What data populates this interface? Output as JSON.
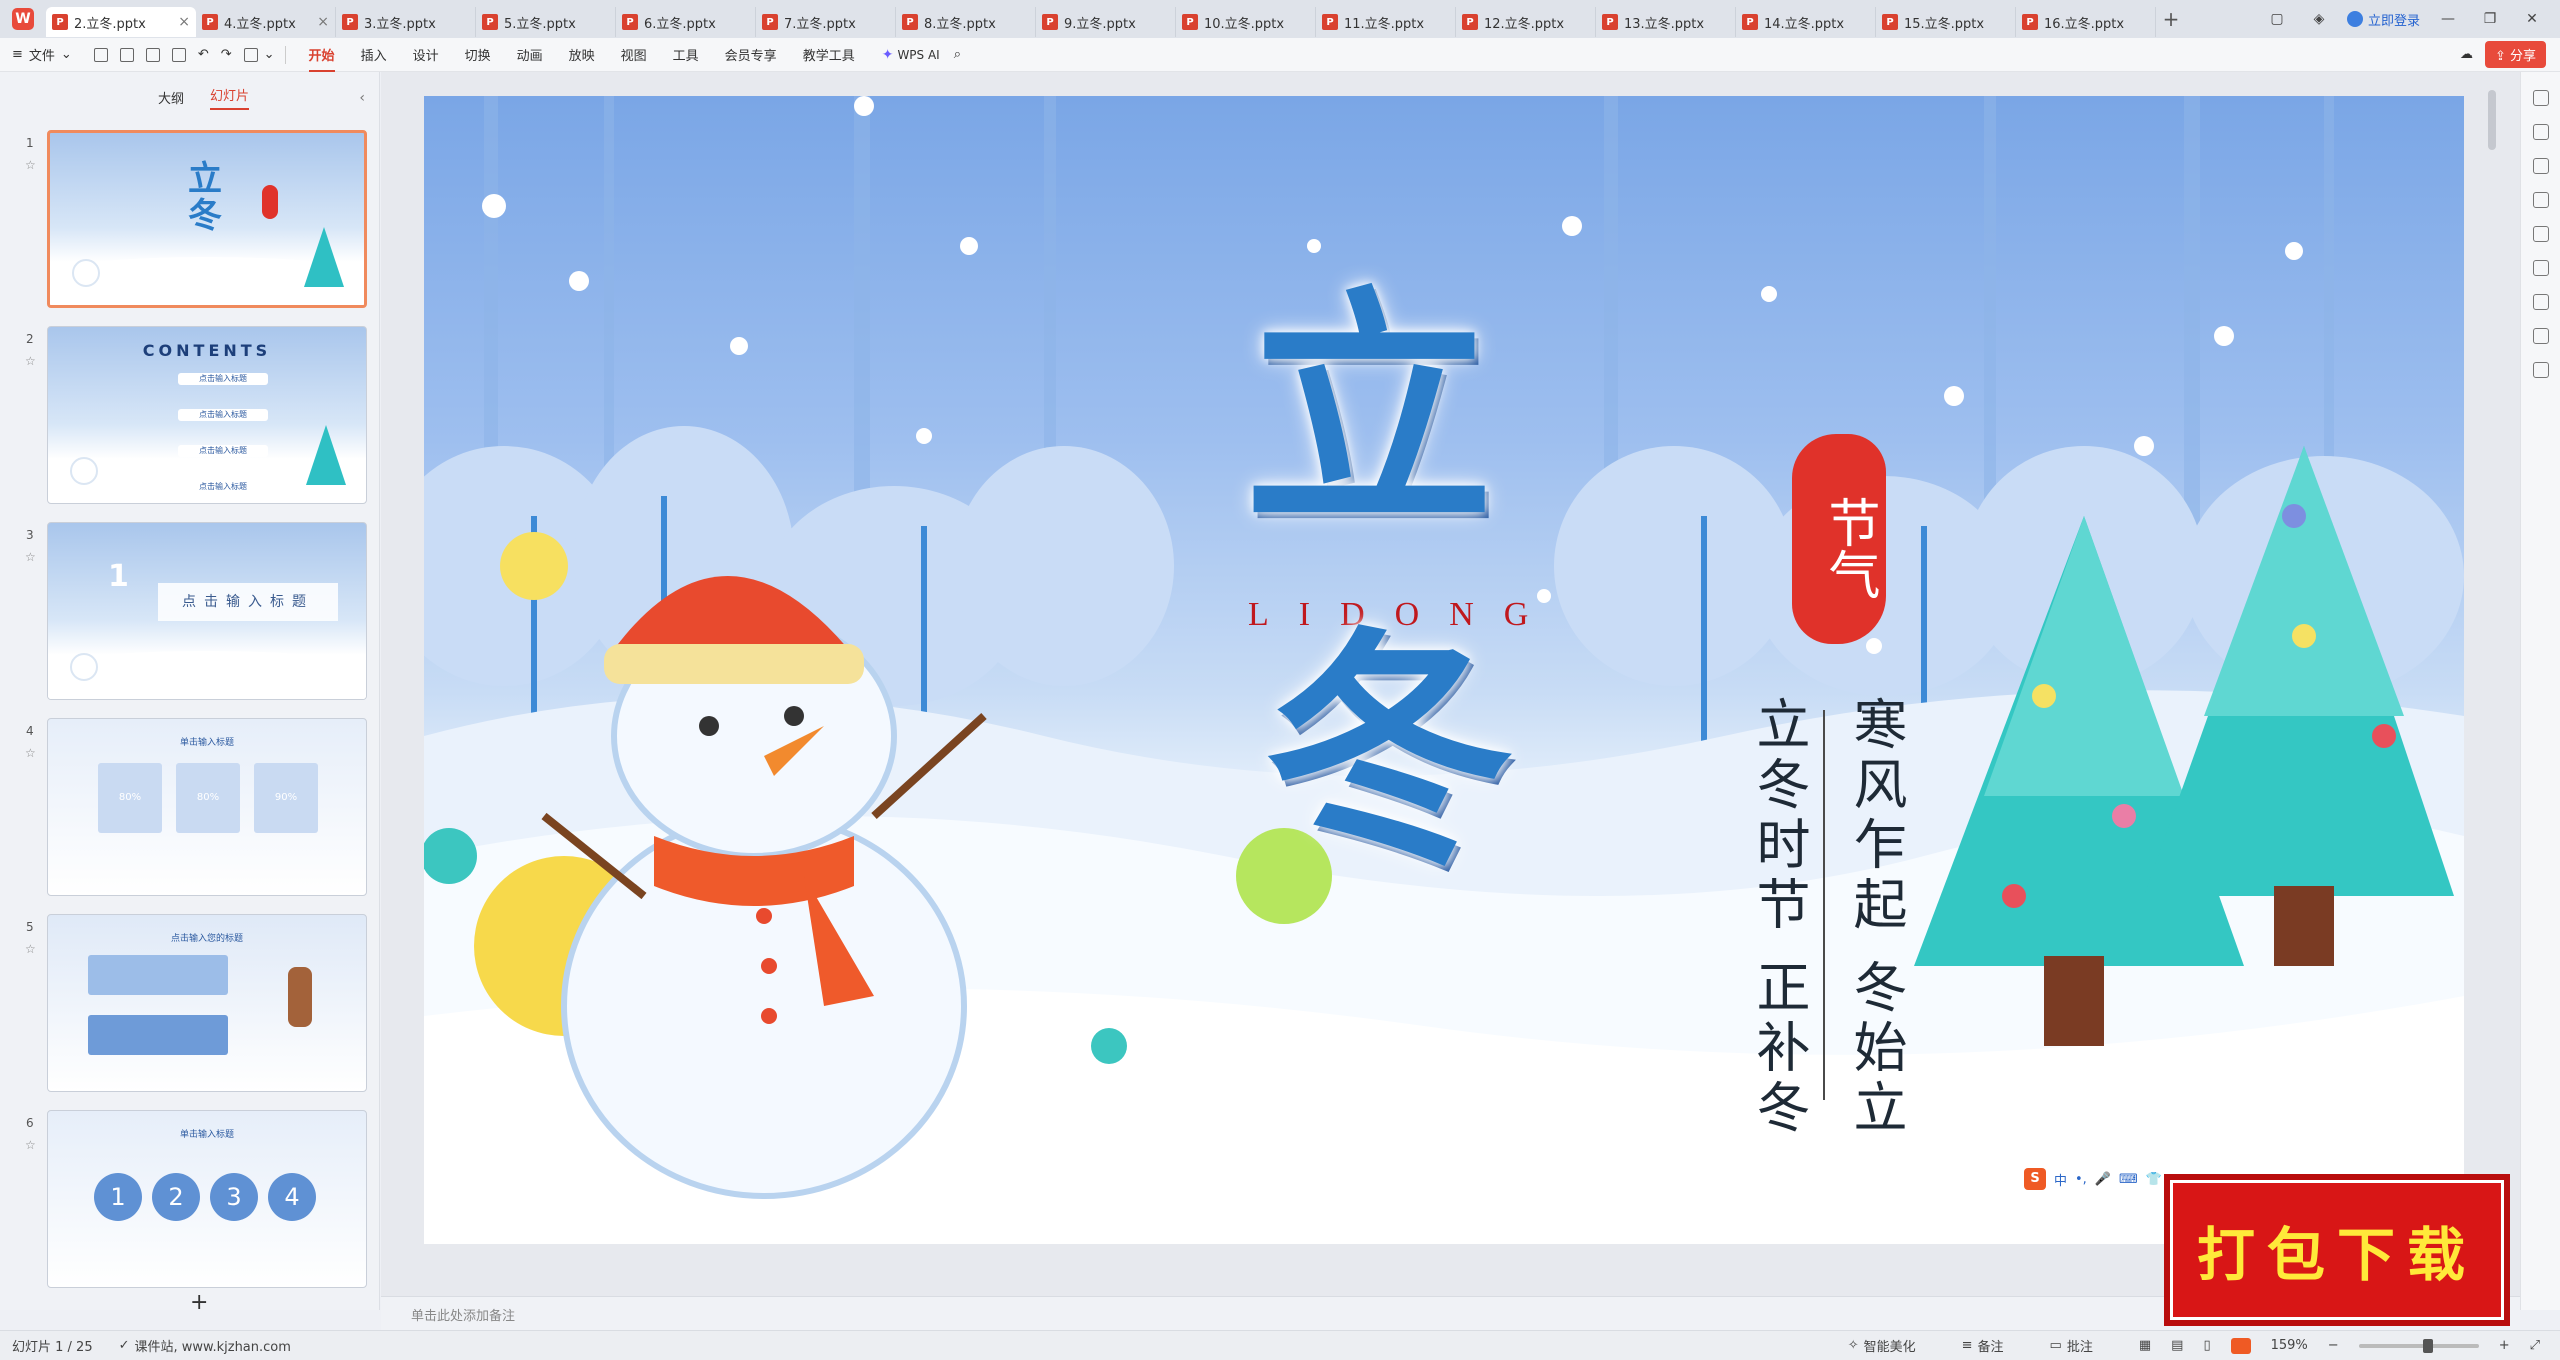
{
  "tabs": [
    {
      "label": "2.立冬.pptx",
      "active": true
    },
    {
      "label": "4.立冬.pptx"
    },
    {
      "label": "3.立冬.pptx"
    },
    {
      "label": "5.立冬.pptx"
    },
    {
      "label": "6.立冬.pptx"
    },
    {
      "label": "7.立冬.pptx"
    },
    {
      "label": "8.立冬.pptx"
    },
    {
      "label": "9.立冬.pptx"
    },
    {
      "label": "10.立冬.pptx"
    },
    {
      "label": "11.立冬.pptx"
    },
    {
      "label": "12.立冬.pptx"
    },
    {
      "label": "13.立冬.pptx"
    },
    {
      "label": "14.立冬.pptx"
    },
    {
      "label": "15.立冬.pptx"
    },
    {
      "label": "16.立冬.pptx"
    }
  ],
  "app_logo": "W",
  "file_icon_letter": "P",
  "login_label": "立即登录",
  "ribbon": {
    "file_label": "文件",
    "menus": [
      "开始",
      "插入",
      "设计",
      "切换",
      "动画",
      "放映",
      "视图",
      "工具",
      "会员专享",
      "教学工具"
    ],
    "wps_ai": "WPS AI",
    "share": "分享"
  },
  "left_panel": {
    "tab_outline": "大纲",
    "tab_slides": "幻灯片",
    "thumbnails": [
      {
        "num": "1"
      },
      {
        "num": "2",
        "title": "CONTENTS",
        "items": [
          "点击输入标题",
          "点击输入标题",
          "点击输入标题",
          "点击输入标题"
        ]
      },
      {
        "num": "3",
        "big": "1",
        "banner": "点击输入标题"
      },
      {
        "num": "4",
        "header": "单击输入标题",
        "cards": [
          "80%",
          "80%",
          "90%"
        ]
      },
      {
        "num": "5",
        "header": "点击输入您的标题"
      },
      {
        "num": "6",
        "header": "单击输入标题",
        "circles": [
          "1",
          "2",
          "3",
          "4"
        ]
      }
    ],
    "add": "+"
  },
  "slide": {
    "title_char1": "立",
    "title_char2": "冬",
    "pinyin": "LIDONG",
    "seal": "节气",
    "poem_right": "寒风乍起 冬始立",
    "poem_left": "立冬时节 正补冬",
    "ime_logo": "S",
    "ime_label": "中"
  },
  "notes_placeholder": "单击此处添加备注",
  "download_badge": "打包下载",
  "status": {
    "slide_info": "幻灯片 1 / 25",
    "source": "课件站, www.kjzhan.com",
    "smart": "智能美化",
    "notes": "备注",
    "comments": "批注",
    "zoom": "159%"
  },
  "colors": {
    "accent": "#d9412f",
    "title_blue": "#2a7cc8",
    "seal_red": "#e0322a",
    "badge_red": "#d81616",
    "badge_text": "#ffe93a"
  }
}
